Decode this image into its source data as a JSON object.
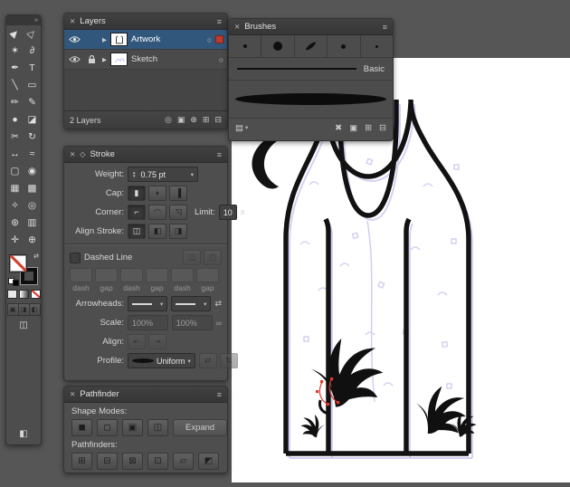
{
  "colors": {
    "window_bg": "#565656",
    "selected_layer": "#31577c",
    "warning_red": "#d23b2e",
    "sketch_lavender": "#cccaf0",
    "artwork_black": "#121212"
  },
  "icons": {
    "close": "✕",
    "panel_menu": "≡",
    "chevron_down": "▾",
    "step_up": "▲",
    "step_down": "▼",
    "swap": "⇄",
    "link": "∞",
    "target": "○",
    "disclosure": "▶",
    "collapse": "»",
    "panel_diamond": "◇",
    "library": "▤",
    "screen_mode": "◫",
    "collapse_panels": "◧"
  },
  "toolbar": {
    "tools": [
      {
        "name": "selection-tool",
        "glyph": "▶",
        "rot": true
      },
      {
        "name": "direct-selection-tool",
        "glyph": "▷",
        "rot": true
      },
      {
        "name": "magic-wand-tool",
        "glyph": "✶"
      },
      {
        "name": "lasso-tool",
        "glyph": "∂"
      },
      {
        "name": "pen-tool",
        "glyph": "✒"
      },
      {
        "name": "type-tool",
        "glyph": "T"
      },
      {
        "name": "line-segment-tool",
        "glyph": "╲"
      },
      {
        "name": "rectangle-tool",
        "glyph": "▭"
      },
      {
        "name": "paintbrush-tool",
        "glyph": "✏"
      },
      {
        "name": "pencil-tool",
        "glyph": "✎"
      },
      {
        "name": "blob-brush-tool",
        "glyph": "●"
      },
      {
        "name": "eraser-tool",
        "glyph": "◪"
      },
      {
        "name": "scissors-tool",
        "glyph": "✂"
      },
      {
        "name": "rotate-tool",
        "glyph": "↻"
      },
      {
        "name": "scale-tool",
        "glyph": "↔"
      },
      {
        "name": "width-tool",
        "glyph": "≈"
      },
      {
        "name": "free-transform-tool",
        "glyph": "▢"
      },
      {
        "name": "shape-builder-tool",
        "glyph": "◉"
      },
      {
        "name": "mesh-tool",
        "glyph": "▦"
      },
      {
        "name": "gradient-tool",
        "glyph": "▩"
      },
      {
        "name": "eyedropper-tool",
        "glyph": "✧"
      },
      {
        "name": "blend-tool",
        "glyph": "◎"
      },
      {
        "name": "symbol-sprayer-tool",
        "glyph": "⊛"
      },
      {
        "name": "column-graph-tool",
        "glyph": "▥"
      },
      {
        "name": "hand-tool",
        "glyph": "✛"
      },
      {
        "name": "zoom-tool",
        "glyph": "⊕"
      }
    ]
  },
  "layers_panel": {
    "title": "Layers",
    "rows": [
      {
        "name": "Artwork",
        "selected": true
      },
      {
        "name": "Sketch",
        "selected": false
      }
    ],
    "count_label": "2 Layers",
    "footer_icons": [
      {
        "name": "locate-object",
        "glyph": "◎"
      },
      {
        "name": "make-clip-mask",
        "glyph": "▣"
      },
      {
        "name": "new-sublayer",
        "glyph": "⊕"
      },
      {
        "name": "new-layer",
        "glyph": "⊞"
      },
      {
        "name": "delete-layer",
        "glyph": "⊟"
      }
    ]
  },
  "brushes_panel": {
    "title": "Brushes",
    "basic_label": "Basic",
    "footer_icons": [
      {
        "name": "remove-brush-stroke",
        "glyph": "✖"
      },
      {
        "name": "brush-options",
        "glyph": "▣"
      },
      {
        "name": "new-brush",
        "glyph": "⊞"
      },
      {
        "name": "delete-brush",
        "glyph": "⊟"
      }
    ]
  },
  "stroke_panel": {
    "title": "Stroke",
    "weight_label": "Weight:",
    "weight_value": "0.75 pt",
    "cap_label": "Cap:",
    "cap_options": [
      {
        "name": "butt-cap",
        "glyph": "▮",
        "sel": true
      },
      {
        "name": "round-cap",
        "glyph": "◗"
      },
      {
        "name": "projecting-cap",
        "glyph": "▐"
      }
    ],
    "corner_label": "Corner:",
    "corner_options": [
      {
        "name": "miter-join",
        "glyph": "⌐",
        "sel": true
      },
      {
        "name": "round-join",
        "glyph": "◠"
      },
      {
        "name": "bevel-join",
        "glyph": "◹"
      }
    ],
    "limit_label": "Limit:",
    "limit_value": "10",
    "limit_unit": "x",
    "align_stroke_label": "Align Stroke:",
    "align_stroke_options": [
      {
        "name": "align-stroke-center",
        "glyph": "◫",
        "sel": true
      },
      {
        "name": "align-stroke-inside",
        "glyph": "◧"
      },
      {
        "name": "align-stroke-outside",
        "glyph": "◨"
      }
    ],
    "dashed_line_label": "Dashed Line",
    "dash_buttons": [
      {
        "name": "preserve-dashes",
        "glyph": "◫",
        "dis": true
      },
      {
        "name": "align-dashes",
        "glyph": "◰",
        "dis": true
      }
    ],
    "dash_gap_labels": [
      "dash",
      "gap",
      "dash",
      "gap",
      "dash",
      "gap"
    ],
    "arrowheads_label": "Arrowheads:",
    "scale_label": "Scale:",
    "scale_start": "100%",
    "scale_end": "100%",
    "align_label": "Align:",
    "align_options": [
      {
        "name": "arrow-tip-extend",
        "glyph": "⇤",
        "dis": true
      },
      {
        "name": "arrow-tip-inside",
        "glyph": "⇥",
        "dis": true
      }
    ],
    "profile_label": "Profile:",
    "profile_value": "Uniform",
    "profile_flip": [
      {
        "name": "flip-along",
        "glyph": "⇄",
        "dis": true
      },
      {
        "name": "flip-across",
        "glyph": "⇅",
        "dis": true
      }
    ]
  },
  "pathfinder_panel": {
    "title": "Pathfinder",
    "shape_modes_label": "Shape Modes:",
    "shape_modes": [
      {
        "name": "unite",
        "glyph": "◼"
      },
      {
        "name": "minus-front",
        "glyph": "◻"
      },
      {
        "name": "intersect",
        "glyph": "▣"
      },
      {
        "name": "exclude",
        "glyph": "◫"
      }
    ],
    "expand_label": "Expand",
    "pathfinders_label": "Pathfinders:",
    "pathfinders": [
      {
        "name": "divide",
        "glyph": "⊞"
      },
      {
        "name": "trim",
        "glyph": "⊟"
      },
      {
        "name": "merge",
        "glyph": "⊠"
      },
      {
        "name": "crop",
        "glyph": "⊡"
      },
      {
        "name": "outline",
        "glyph": "▱"
      },
      {
        "name": "minus-back",
        "glyph": "◩"
      }
    ]
  }
}
